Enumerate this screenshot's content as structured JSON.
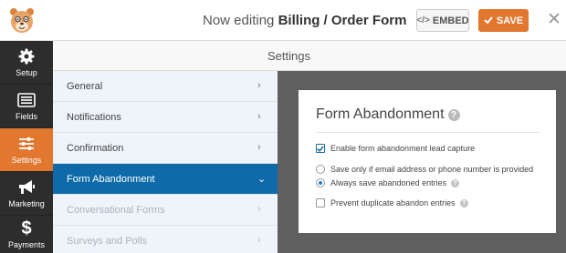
{
  "header": {
    "editing_prefix": "Now editing",
    "form_name": "Billing / Order Form",
    "embed_label": "EMBED",
    "embed_icon": "code-icon",
    "save_label": "SAVE",
    "save_icon": "checkmark-icon",
    "close_icon": "close-icon"
  },
  "sidebar": {
    "items": [
      {
        "label": "Setup",
        "icon": "gear-icon"
      },
      {
        "label": "Fields",
        "icon": "fields-list-icon"
      },
      {
        "label": "Settings",
        "icon": "sliders-icon",
        "active": true
      },
      {
        "label": "Marketing",
        "icon": "megaphone-icon"
      },
      {
        "label": "Payments",
        "icon": "dollar-icon"
      }
    ]
  },
  "settings_title": "Settings",
  "settings_menu": [
    {
      "label": "General"
    },
    {
      "label": "Notifications"
    },
    {
      "label": "Confirmation"
    },
    {
      "label": "Form Abandonment",
      "active": true
    },
    {
      "label": "Conversational Forms",
      "disabled": true
    },
    {
      "label": "Surveys and Polls",
      "disabled": true
    }
  ],
  "panel": {
    "title": "Form Abandonment",
    "enable_label": "Enable form abandonment lead capture",
    "enable_checked": true,
    "radio_email_label": "Save only if email address or phone number is provided",
    "radio_always_label": "Always save abandoned entries",
    "selected_option": "always",
    "prevent_duplicate_label": "Prevent duplicate abandon entries",
    "prevent_duplicate_checked": false
  },
  "colors": {
    "accent_orange": "#e27730",
    "active_blue": "#0e6aa8",
    "sidebar_dark": "#2d2d2d"
  }
}
